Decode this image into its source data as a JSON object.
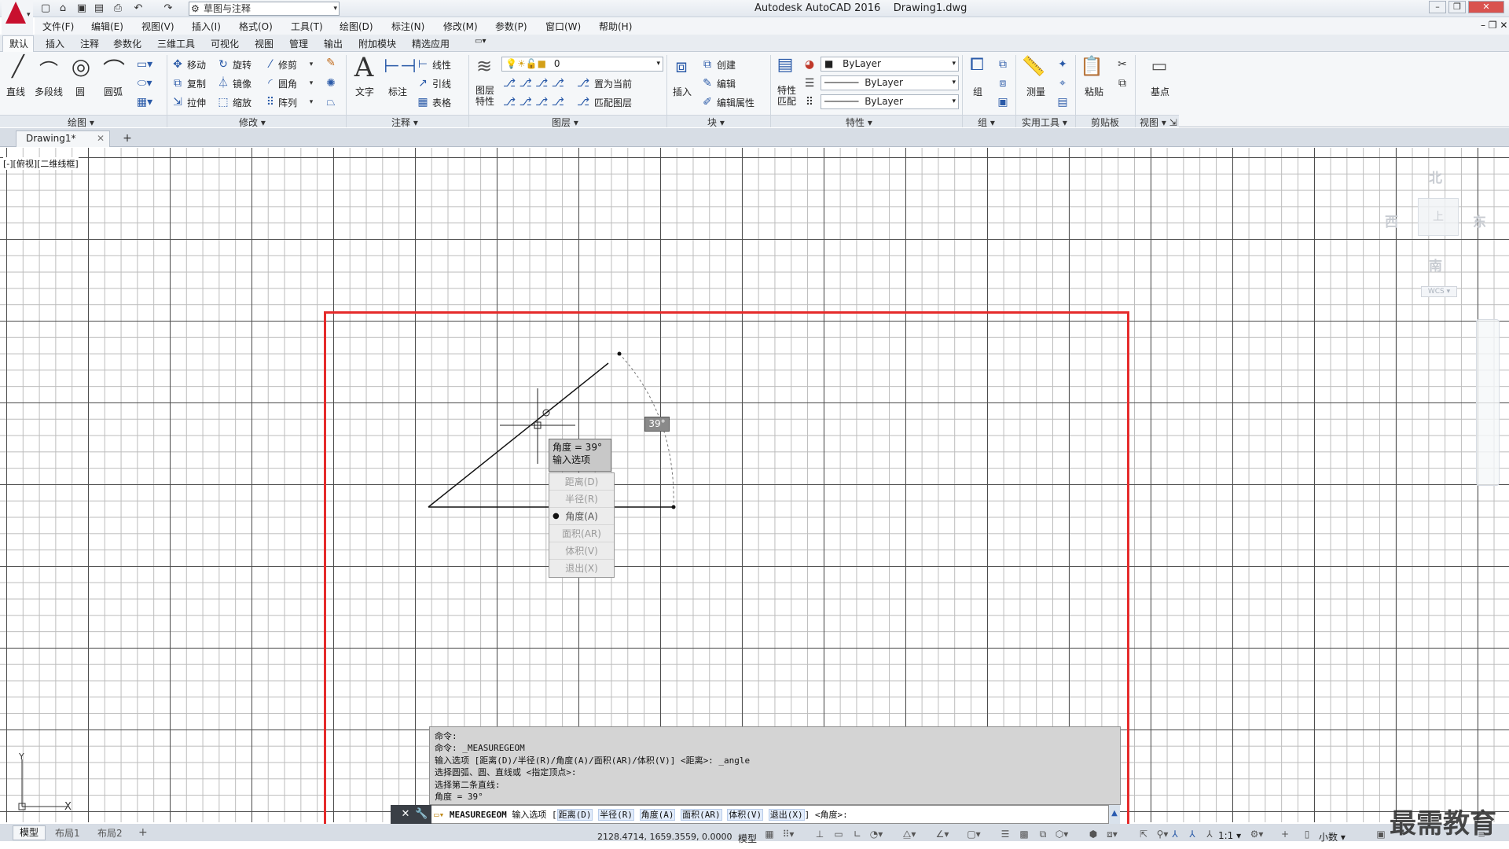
{
  "titlebar": {
    "app_title": "Autodesk AutoCAD 2016",
    "file_name": "Drawing1.dwg",
    "workspace": "草图与注释"
  },
  "menu": [
    "文件(F)",
    "编辑(E)",
    "视图(V)",
    "插入(I)",
    "格式(O)",
    "工具(T)",
    "绘图(D)",
    "标注(N)",
    "修改(M)",
    "参数(P)",
    "窗口(W)",
    "帮助(H)"
  ],
  "ribbon_tabs": [
    "默认",
    "插入",
    "注释",
    "参数化",
    "三维工具",
    "可视化",
    "视图",
    "管理",
    "输出",
    "附加模块",
    "精选应用"
  ],
  "ribbon": {
    "draw": {
      "line": "直线",
      "polyline": "多段线",
      "circle": "圆",
      "arc": "圆弧",
      "panel": "绘图"
    },
    "modify": {
      "move": "移动",
      "rotate": "旋转",
      "trim": "修剪",
      "copy": "复制",
      "mirror": "镜像",
      "fillet": "圆角",
      "stretch": "拉伸",
      "scale": "缩放",
      "array": "阵列",
      "panel": "修改"
    },
    "annotation": {
      "text": "文字",
      "dimension": "标注",
      "linear": "线性",
      "leader": "引线",
      "table": "表格",
      "panel": "注释"
    },
    "layers": {
      "layer_props": "图层特性",
      "current_layer": "0",
      "set_current": "置为当前",
      "match_layer": "匹配图层",
      "panel": "图层"
    },
    "block": {
      "insert": "插入",
      "create": "创建",
      "edit": "编辑",
      "edit_attr": "编辑属性",
      "panel": "块"
    },
    "properties": {
      "match": "特性匹配",
      "color": "ByLayer",
      "linetype": "ByLayer",
      "lineweight": "ByLayer",
      "panel": "特性"
    },
    "groups": {
      "group": "组",
      "panel": "组"
    },
    "utilities": {
      "measure": "测量",
      "panel": "实用工具"
    },
    "clipboard": {
      "paste": "粘贴",
      "panel": "剪贴板"
    },
    "view": {
      "base": "基点",
      "panel": "视图"
    }
  },
  "file_tab": "Drawing1*",
  "viewport_label": "[-][俯视][二维线框]",
  "viewcube": {
    "north": "北",
    "south": "南",
    "east": "东",
    "west": "西",
    "top": "上",
    "wcs": "WCS"
  },
  "tooltip": {
    "line1": "角度 = 39°",
    "line2": "输入选项"
  },
  "angle_dim": "39°",
  "context_menu": [
    {
      "label": "距离(D)",
      "selected": false
    },
    {
      "label": "半径(R)",
      "selected": false
    },
    {
      "label": "角度(A)",
      "selected": true
    },
    {
      "label": "面积(AR)",
      "selected": false
    },
    {
      "label": "体积(V)",
      "selected": false
    },
    {
      "label": "退出(X)",
      "selected": false
    }
  ],
  "command_history": [
    "命令:",
    "命令: _MEASUREGEOM",
    "输入选项 [距离(D)/半径(R)/角度(A)/面积(AR)/体积(V)] <距离>: _angle",
    "选择圆弧、圆、直线或 <指定顶点>:",
    "选择第二条直线:",
    "角度 = 39°"
  ],
  "command_line": {
    "cmd": "MEASUREGEOM",
    "prefix": "输入选项 [",
    "opts": [
      "距离(D)",
      "半径(R)",
      "角度(A)",
      "面积(AR)",
      "体积(V)",
      "退出(X)"
    ],
    "suffix": "] <角度>:"
  },
  "layout_tabs": [
    "模型",
    "布局1",
    "布局2"
  ],
  "status": {
    "coords": "2128.4714, 1659.3559, 0.0000",
    "model": "模型",
    "scale": "1:1",
    "units": "小数"
  },
  "watermark": "最需教育",
  "ucs": {
    "x": "X",
    "y": "Y"
  }
}
